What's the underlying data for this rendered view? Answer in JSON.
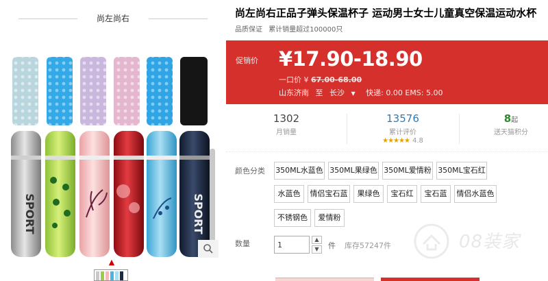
{
  "shop": {
    "name": "尚左尚右"
  },
  "product": {
    "title": "尚左尚右正品子弹头保温杯子 运动男士女士儿童真空保温运动水杯",
    "badges": [
      "品质保证",
      "累计销量超过100000只"
    ]
  },
  "price": {
    "label": "促销价",
    "value": "¥17.90-18.90",
    "original_prefix": "一口价 ¥",
    "original_value": "67.00-68.00"
  },
  "shipping": {
    "from": "山东济南",
    "to_word": "至",
    "dest": "长沙",
    "fee_text": "快递: 0.00 EMS: 5.00"
  },
  "stats": {
    "monthly_sales": {
      "value": "1302",
      "label": "月销量"
    },
    "reviews": {
      "value": "13576",
      "label": "累计评价",
      "rating": "4.8",
      "stars": "★★★★★"
    },
    "points": {
      "value": "8",
      "unit": "起",
      "label": "送天猫积分"
    }
  },
  "options": {
    "label": "颜色分类",
    "items": [
      "350ML水蓝色",
      "350ML果绿色",
      "350ML爱情粉",
      "350ML宝石红",
      "水蓝色",
      "情侣宝石蓝",
      "果绿色",
      "宝石红",
      "宝石蓝",
      "情侣水蓝色",
      "不锈钢色",
      "爱情粉"
    ]
  },
  "quantity": {
    "label": "数量",
    "value": "1",
    "unit": "件",
    "stock": "库存57247件"
  },
  "colors": {
    "price_bg": "#d6302c",
    "stat_blue": "#2e7bb6",
    "stat_green": "#2b8a2b",
    "star": "#e6a300"
  },
  "icons": {
    "zoom": "magnifier-icon",
    "thumb_up": "chevron-up-icon",
    "qty_up": "triangle-up-icon",
    "qty_down": "triangle-down-icon",
    "shipping_caret": "chevron-down-icon"
  },
  "watermark": {
    "text": "08装家"
  }
}
